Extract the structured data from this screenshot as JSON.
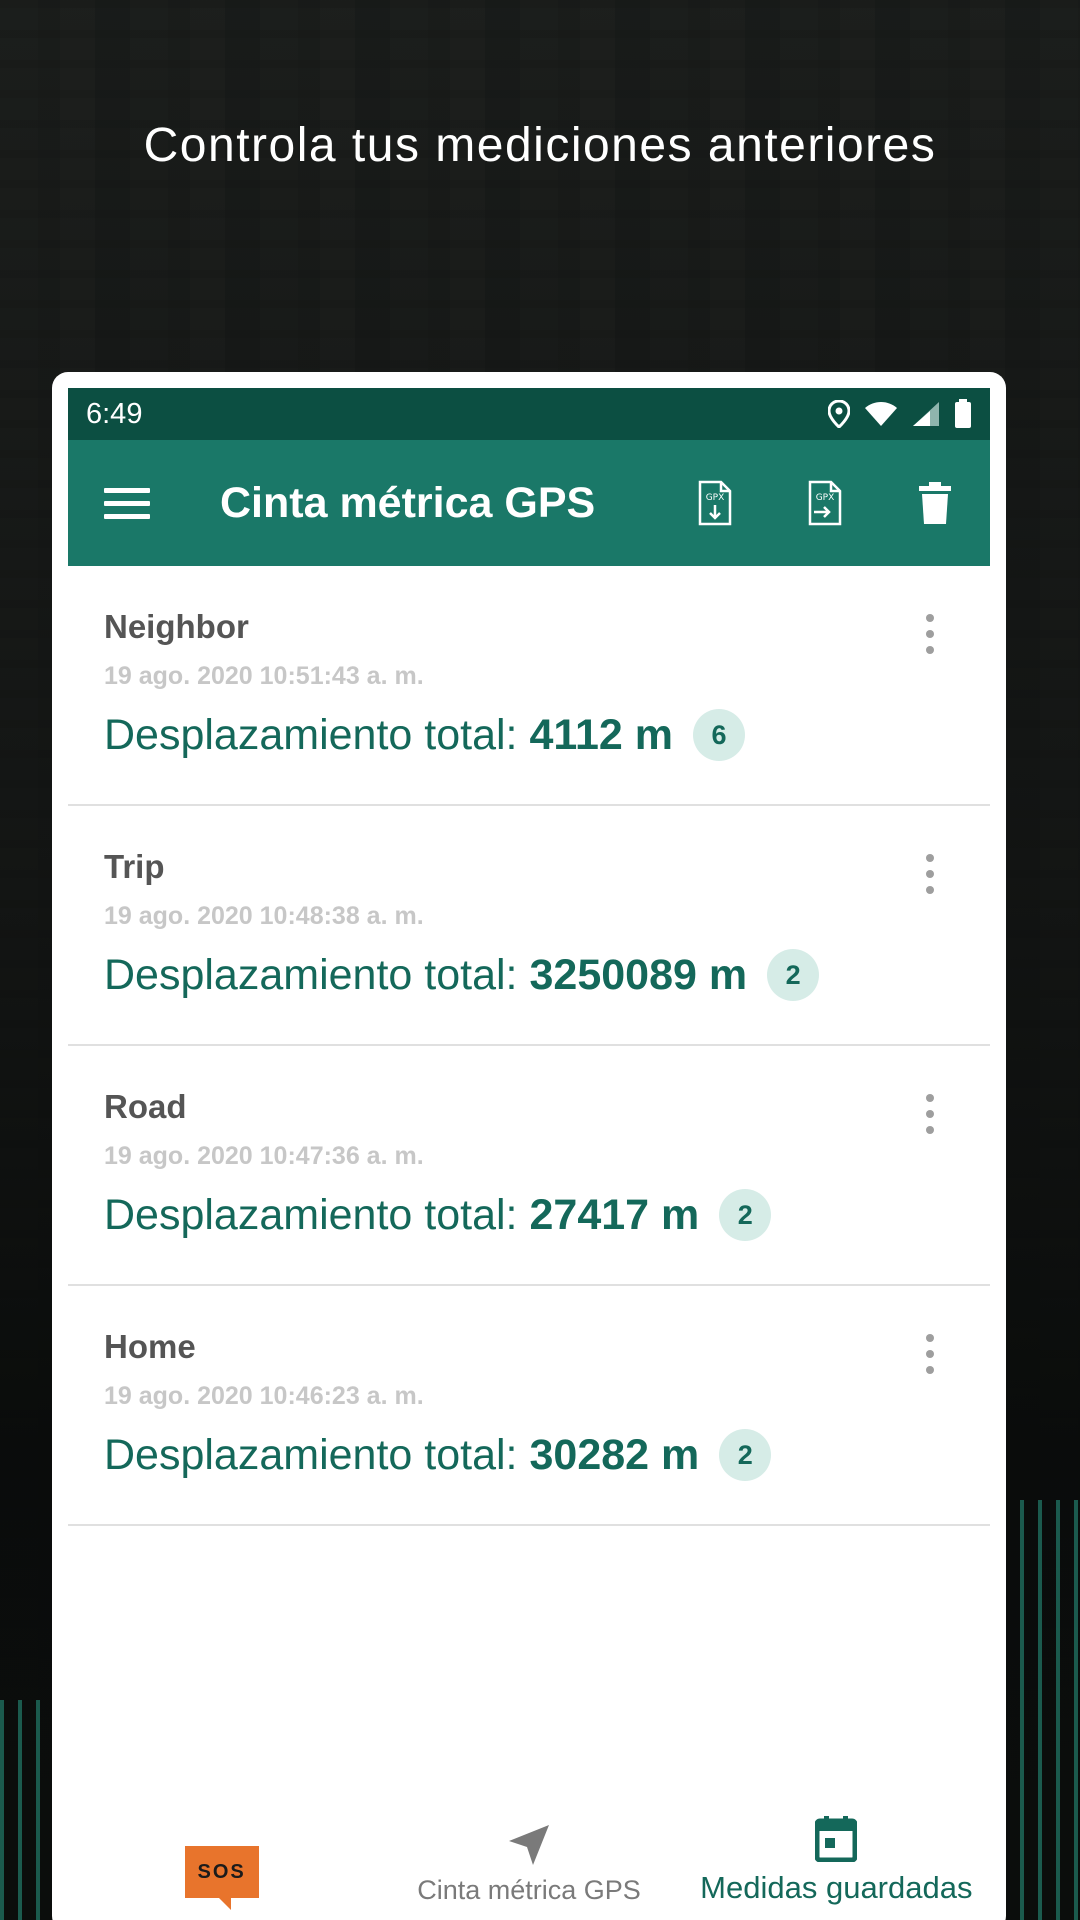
{
  "headline": "Controla tus mediciones anteriores",
  "statusbar": {
    "time": "6:49"
  },
  "appbar": {
    "title": "Cinta métrica GPS",
    "actions": [
      "gpx-import-icon",
      "gpx-export-icon",
      "trash-icon"
    ]
  },
  "colors": {
    "primary": "#1a7868",
    "primary_dark": "#0c4f42",
    "accent_text": "#14685a",
    "badge_bg": "#d6ece7",
    "sos": "#e8742c"
  },
  "items": [
    {
      "name": "Neighbor",
      "date": "19 ago. 2020 10:51:43 a. m.",
      "total_label": "Desplazamiento total:",
      "total_value": "4112 m",
      "count": "6"
    },
    {
      "name": "Trip",
      "date": "19 ago. 2020 10:48:38 a. m.",
      "total_label": "Desplazamiento total:",
      "total_value": "3250089 m",
      "count": "2"
    },
    {
      "name": "Road",
      "date": "19 ago. 2020 10:47:36 a. m.",
      "total_label": "Desplazamiento total:",
      "total_value": "27417 m",
      "count": "2"
    },
    {
      "name": "Home",
      "date": "19 ago. 2020 10:46:23 a. m.",
      "total_label": "Desplazamiento total:",
      "total_value": "30282 m",
      "count": "2"
    }
  ],
  "bottomnav": {
    "sos_label": "SOS",
    "items": [
      {
        "label": "Cinta métrica GPS",
        "icon": "navigation-arrow-icon"
      },
      {
        "label": "Medidas guardadas",
        "icon": "calendar-icon",
        "active": true
      }
    ]
  }
}
